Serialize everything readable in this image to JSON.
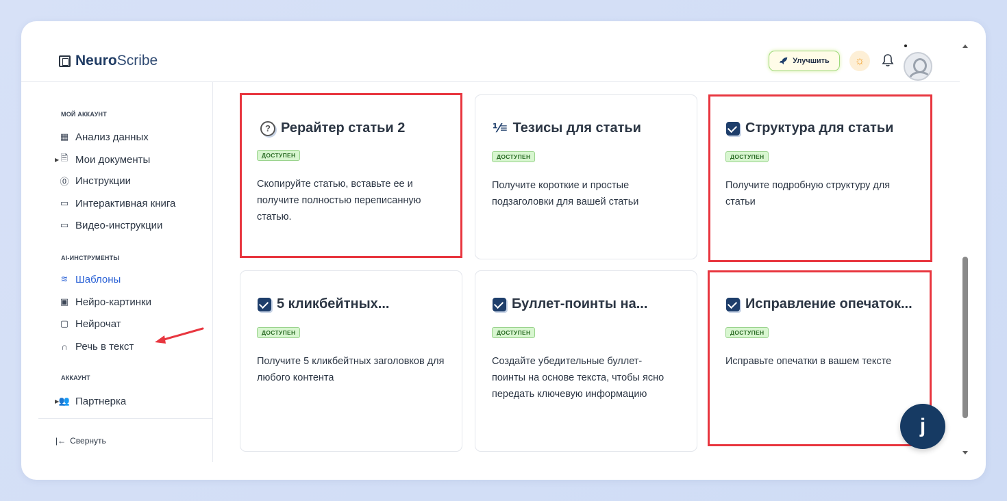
{
  "app": {
    "logo_bold": "Neuro",
    "logo_light": "Scribe"
  },
  "header": {
    "upgrade_label": "Улучшить"
  },
  "sidebar": {
    "sections": [
      {
        "title": "МОЙ АККАУНТ",
        "items": [
          {
            "label": "Анализ данных",
            "icon": "grid-icon"
          },
          {
            "label": "Мои документы",
            "icon": "document-icon"
          },
          {
            "label": "Инструкции",
            "icon": "question-icon"
          },
          {
            "label": "Интерактивная книга",
            "icon": "book-icon"
          },
          {
            "label": "Видео-инструкции",
            "icon": "video-icon"
          }
        ]
      },
      {
        "title": "AI-ИНСТРУМЕНТЫ",
        "items": [
          {
            "label": "Шаблоны",
            "icon": "layers-icon"
          },
          {
            "label": "Нейро-картинки",
            "icon": "image-icon"
          },
          {
            "label": "Нейрочат",
            "icon": "chat-icon"
          },
          {
            "label": "Речь в текст",
            "icon": "headphones-icon"
          }
        ]
      },
      {
        "title": "АККАУНТ",
        "items": [
          {
            "label": "Партнерка",
            "icon": "users-icon"
          }
        ]
      }
    ],
    "collapse_label": "Свернуть"
  },
  "cards": [
    {
      "title": "Рерайтер статьи 2",
      "badge": "ДОСТУПЕН",
      "desc": "Скопируйте статью, вставьте ее и получите полностью переписанную статью."
    },
    {
      "title": "Тезисы для статьи",
      "badge": "ДОСТУПЕН",
      "desc": "Получите короткие и простые подзаголовки для вашей статьи"
    },
    {
      "title": "Структура для статьи",
      "badge": "ДОСТУПЕН",
      "desc": "Получите подробную структуру для статьи"
    },
    {
      "title": "5 кликбейтных...",
      "badge": "ДОСТУПЕН",
      "desc": "Получите 5 кликбейтных заголовков для любого контента"
    },
    {
      "title": "Буллет-поинты на...",
      "badge": "ДОСТУПЕН",
      "desc": "Создайте убедительные буллет-поинты на основе текста, чтобы ясно передать ключевую информацию"
    },
    {
      "title": "Исправление опечаток...",
      "badge": "ДОСТУПЕН",
      "desc": "Исправьте опечатки в вашем тексте"
    }
  ],
  "chat_button_glyph": "ј",
  "colors": {
    "highlight": "#e8363f",
    "active_nav": "#2b62d6",
    "badge_bg": "#d8f6d0",
    "brand_dark": "#163a63"
  }
}
